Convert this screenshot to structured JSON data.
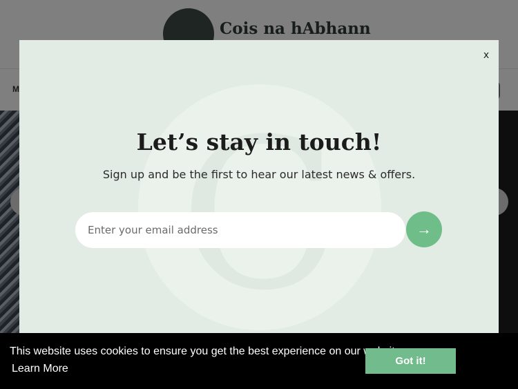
{
  "site": {
    "name": "Cois na hAbhann",
    "nav_fragment": "M"
  },
  "modal": {
    "close_label": "x",
    "title": "Let’s stay in touch!",
    "subtitle": "Sign up and be the first to hear our latest news & offers.",
    "email_placeholder": "Enter your email address",
    "submit_icon": "→"
  },
  "cookie": {
    "message": "This website uses cookies to ensure you get the best experience on our website.",
    "learn_more": "Learn More",
    "accept": "Got it!"
  },
  "colors": {
    "modal_bg": "#e2ece4",
    "accent": "#6fbe89",
    "cookie_bg": "#000000"
  },
  "icons": {
    "close": "close-icon",
    "submit": "arrow-right-icon",
    "logo": "logo-icon",
    "search": "search-icon"
  }
}
